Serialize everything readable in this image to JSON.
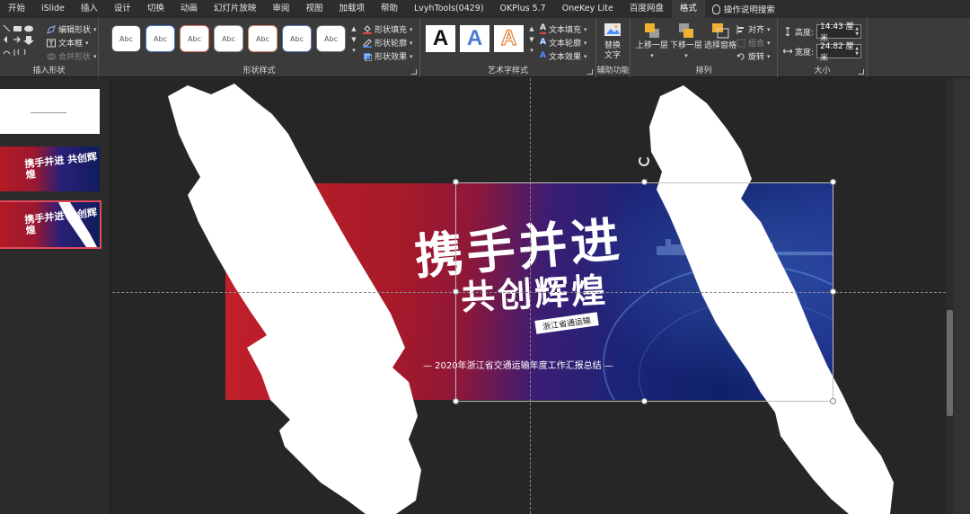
{
  "tabs": [
    {
      "label": "开始"
    },
    {
      "label": "iSlide"
    },
    {
      "label": "插入"
    },
    {
      "label": "设计"
    },
    {
      "label": "切换"
    },
    {
      "label": "动画"
    },
    {
      "label": "幻灯片放映"
    },
    {
      "label": "审阅"
    },
    {
      "label": "视图"
    },
    {
      "label": "加载项"
    },
    {
      "label": "帮助"
    },
    {
      "label": "LvyhTools(0429)"
    },
    {
      "label": "OKPlus 5.7"
    },
    {
      "label": "OneKey Lite"
    },
    {
      "label": "百度网盘"
    },
    {
      "label": "格式"
    }
  ],
  "help_search": "操作说明搜索",
  "ribbon": {
    "insert_shapes": {
      "label": "插入形状",
      "edit_shape": "编辑形状",
      "text_box": "文本框",
      "merge_shapes": "合并形状"
    },
    "shape_styles": {
      "label": "形状样式",
      "gallery": [
        "Abc",
        "Abc",
        "Abc",
        "Abc",
        "Abc",
        "Abc",
        "Abc"
      ],
      "fill": "形状填充",
      "outline": "形状轮廓",
      "effects": "形状效果"
    },
    "wordart": {
      "label": "艺术字样式",
      "samples": [
        "A",
        "A",
        "A"
      ],
      "text_fill": "文本填充",
      "text_outline": "文本轮廓",
      "text_effects": "文本效果"
    },
    "accessibility": {
      "label": "辅助功能",
      "alt_text_line1": "替换",
      "alt_text_line2": "文字"
    },
    "arrange": {
      "label": "排列",
      "bring_forward": "上移一层",
      "send_backward": "下移一层",
      "selection_pane": "选择窗格",
      "align": "对齐",
      "group": "组合",
      "rotate": "旋转"
    },
    "size": {
      "label": "大小",
      "height_label": "高度:",
      "height_value": "14.43 厘米",
      "width_label": "宽度:",
      "width_value": "24.82 厘米"
    }
  },
  "thumbnails": {
    "slide2_text": "携手并进 共创辉煌",
    "slide3_text": "携手并进 共创辉煌"
  },
  "slide": {
    "title_line1": "携手并进",
    "title_line2": "共创辉煌",
    "stamp": "浙江省通运输",
    "subtitle": "—  2020年浙江省交通运输年度工作汇报总结  —"
  },
  "colors": {
    "ribbon_bg": "#3b3b3b",
    "canvas_bg": "#262626",
    "slide_red": "#c2202b",
    "slide_blue": "#10216a",
    "selected_thumb_border": "#e04a5b"
  }
}
